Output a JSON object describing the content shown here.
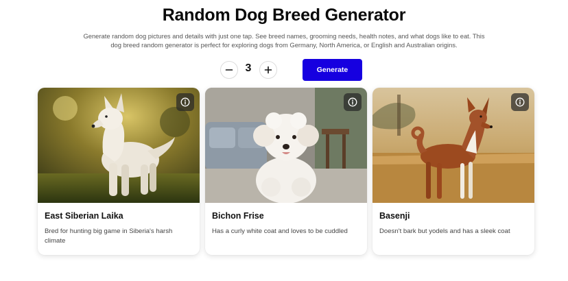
{
  "header": {
    "title": "Random Dog Breed Generator",
    "description": "Generate random dog pictures and details with just one tap. See breed names, grooming needs, health notes, and what dogs like to eat. This dog breed random generator is perfect for exploring dogs from Germany, North America, or English and Australian origins."
  },
  "controls": {
    "count": "3",
    "decrement_icon": "minus-icon",
    "increment_icon": "plus-icon",
    "generate_label": "Generate",
    "accent_color": "#1600e0"
  },
  "cards": [
    {
      "name": "East Siberian Laika",
      "description": "Bred for hunting big game in Siberia's harsh climate",
      "image_icon": "dog-photo",
      "info_icon": "info-icon"
    },
    {
      "name": "Bichon Frise",
      "description": "Has a curly white coat and loves to be cuddled",
      "image_icon": "dog-photo",
      "info_icon": "info-icon"
    },
    {
      "name": "Basenji",
      "description": "Doesn't bark but yodels and has a sleek coat",
      "image_icon": "dog-photo",
      "info_icon": "info-icon"
    }
  ]
}
